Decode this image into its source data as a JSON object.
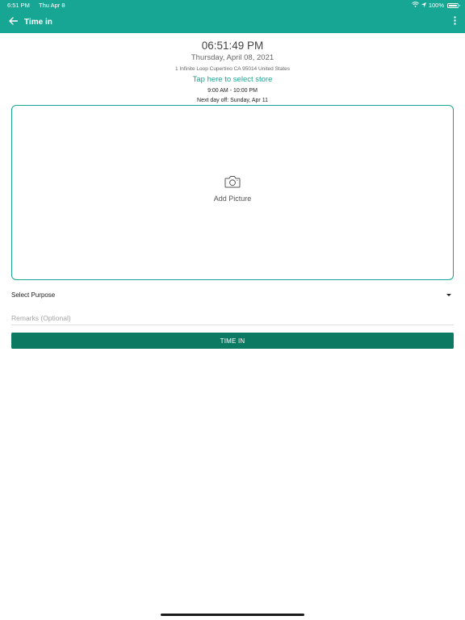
{
  "status_bar": {
    "time": "6:51 PM",
    "date": "Thu Apr 8",
    "battery": "100%"
  },
  "toolbar": {
    "title": "Time in",
    "back_icon": "arrow-left-icon",
    "menu_icon": "more-vertical-icon"
  },
  "header": {
    "time": "06:51:49 PM",
    "date": "Thursday, April 08, 2021",
    "address": "1 Infinite Loop Cupertino CA 95014 United States",
    "store_link": "Tap here to select store",
    "hours": "9:00 AM - 10:00 PM",
    "next_day_off": "Next day off: Sunday, Apr 11"
  },
  "picture": {
    "icon": "camera-icon",
    "label": "Add Picture"
  },
  "form": {
    "purpose_label": "Select Purpose",
    "remarks_placeholder": "Remarks (Optional)",
    "remarks_value": "",
    "submit_label": "TIME IN"
  },
  "colors": {
    "primary": "#17a594",
    "button": "#0c7a62"
  }
}
